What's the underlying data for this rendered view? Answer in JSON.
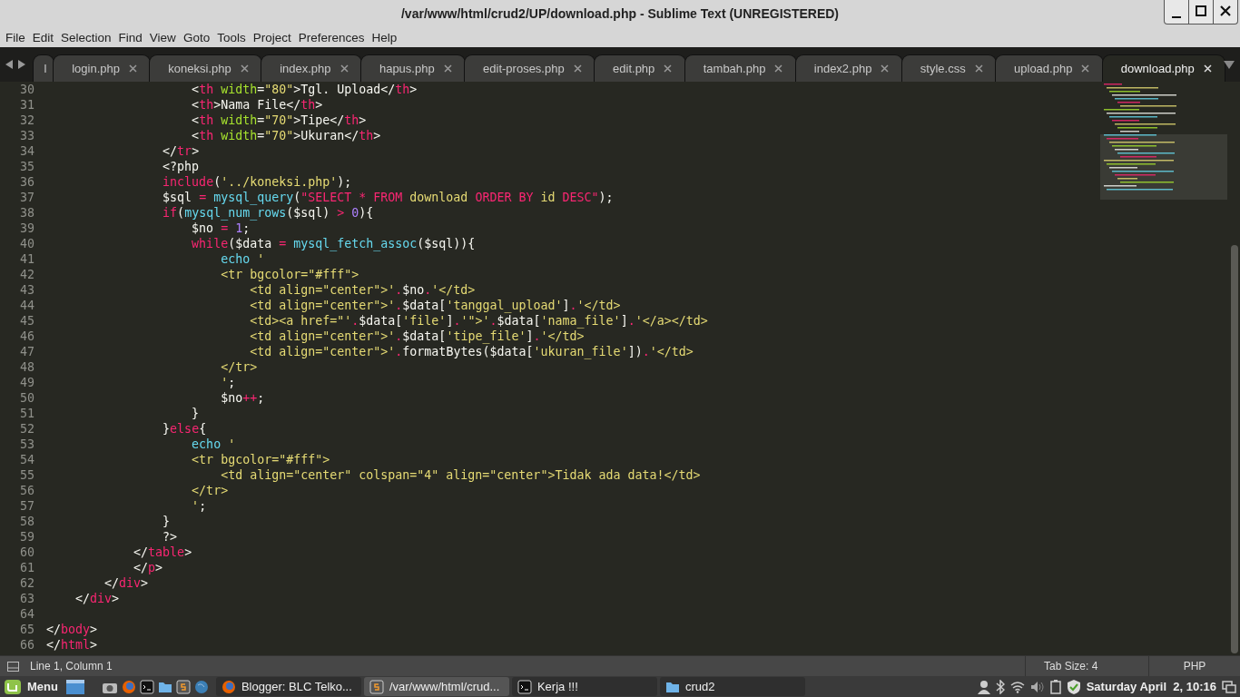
{
  "window": {
    "title": "/var/www/html/crud2/UP/download.php - Sublime Text (UNREGISTERED)"
  },
  "menu": [
    "File",
    "Edit",
    "Selection",
    "Find",
    "View",
    "Goto",
    "Tools",
    "Project",
    "Preferences",
    "Help"
  ],
  "overflow_tab": {
    "label": "l"
  },
  "tabs": [
    {
      "label": "login.php",
      "selected": false
    },
    {
      "label": "koneksi.php",
      "selected": false
    },
    {
      "label": "index.php",
      "selected": false
    },
    {
      "label": "hapus.php",
      "selected": false
    },
    {
      "label": "edit-proses.php",
      "selected": false
    },
    {
      "label": "edit.php",
      "selected": false
    },
    {
      "label": "tambah.php",
      "selected": false
    },
    {
      "label": "index2.php",
      "selected": false
    },
    {
      "label": "style.css",
      "selected": false
    },
    {
      "label": "upload.php",
      "selected": false
    },
    {
      "label": "download.php",
      "selected": true
    }
  ],
  "editor": {
    "lines": [
      {
        "number": "30",
        "tokens": [
          {
            "kind": "plain",
            "text": "                    <"
          },
          {
            "kind": "keyword",
            "text": "th"
          },
          {
            "kind": "attribute",
            "text": " width"
          },
          {
            "kind": "plain",
            "text": "="
          },
          {
            "kind": "string",
            "text": "\"80\""
          },
          {
            "kind": "plain",
            "text": ">Tgl. Upload</"
          },
          {
            "kind": "keyword",
            "text": "th"
          },
          {
            "kind": "plain",
            "text": ">"
          }
        ]
      },
      {
        "number": "31",
        "tokens": [
          {
            "kind": "plain",
            "text": "                    <"
          },
          {
            "kind": "keyword",
            "text": "th"
          },
          {
            "kind": "plain",
            "text": ">Nama File</"
          },
          {
            "kind": "keyword",
            "text": "th"
          },
          {
            "kind": "plain",
            "text": ">"
          }
        ]
      },
      {
        "number": "32",
        "tokens": [
          {
            "kind": "plain",
            "text": "                    <"
          },
          {
            "kind": "keyword",
            "text": "th"
          },
          {
            "kind": "attribute",
            "text": " width"
          },
          {
            "kind": "plain",
            "text": "="
          },
          {
            "kind": "string",
            "text": "\"70\""
          },
          {
            "kind": "plain",
            "text": ">Tipe</"
          },
          {
            "kind": "keyword",
            "text": "th"
          },
          {
            "kind": "plain",
            "text": ">"
          }
        ]
      },
      {
        "number": "33",
        "tokens": [
          {
            "kind": "plain",
            "text": "                    <"
          },
          {
            "kind": "keyword",
            "text": "th"
          },
          {
            "kind": "attribute",
            "text": " width"
          },
          {
            "kind": "plain",
            "text": "="
          },
          {
            "kind": "string",
            "text": "\"70\""
          },
          {
            "kind": "plain",
            "text": ">Ukuran</"
          },
          {
            "kind": "keyword",
            "text": "th"
          },
          {
            "kind": "plain",
            "text": ">"
          }
        ]
      },
      {
        "number": "34",
        "tokens": [
          {
            "kind": "plain",
            "text": "                </"
          },
          {
            "kind": "keyword",
            "text": "tr"
          },
          {
            "kind": "plain",
            "text": ">"
          }
        ]
      },
      {
        "number": "35",
        "tokens": [
          {
            "kind": "plain",
            "text": "                <?php"
          }
        ]
      },
      {
        "number": "36",
        "tokens": [
          {
            "kind": "keyword",
            "text": "                include"
          },
          {
            "kind": "plain",
            "text": "("
          },
          {
            "kind": "string",
            "text": "'../koneksi.php'"
          },
          {
            "kind": "plain",
            "text": ");"
          }
        ]
      },
      {
        "number": "37",
        "tokens": [
          {
            "kind": "plain",
            "text": "                $sql "
          },
          {
            "kind": "keyword",
            "text": "="
          },
          {
            "kind": "function",
            "text": " mysql_query"
          },
          {
            "kind": "plain",
            "text": "("
          },
          {
            "kind": "keyword",
            "text": "\"SELECT * FROM "
          },
          {
            "kind": "string",
            "text": "download "
          },
          {
            "kind": "keyword",
            "text": "ORDER BY "
          },
          {
            "kind": "string",
            "text": "id "
          },
          {
            "kind": "keyword",
            "text": "DESC\""
          },
          {
            "kind": "plain",
            "text": ");"
          }
        ]
      },
      {
        "number": "38",
        "tokens": [
          {
            "kind": "keyword",
            "text": "                if"
          },
          {
            "kind": "plain",
            "text": "("
          },
          {
            "kind": "function",
            "text": "mysql_num_rows"
          },
          {
            "kind": "plain",
            "text": "($sql) "
          },
          {
            "kind": "keyword",
            "text": ">"
          },
          {
            "kind": "number",
            "text": " 0"
          },
          {
            "kind": "plain",
            "text": "){"
          }
        ]
      },
      {
        "number": "39",
        "tokens": [
          {
            "kind": "plain",
            "text": "                    $no "
          },
          {
            "kind": "keyword",
            "text": "="
          },
          {
            "kind": "number",
            "text": " 1"
          },
          {
            "kind": "plain",
            "text": ";"
          }
        ]
      },
      {
        "number": "40",
        "tokens": [
          {
            "kind": "keyword",
            "text": "                    while"
          },
          {
            "kind": "plain",
            "text": "($data "
          },
          {
            "kind": "keyword",
            "text": "="
          },
          {
            "kind": "function",
            "text": " mysql_fetch_assoc"
          },
          {
            "kind": "plain",
            "text": "($sql)){"
          }
        ]
      },
      {
        "number": "41",
        "tokens": [
          {
            "kind": "function",
            "text": "                        echo"
          },
          {
            "kind": "string",
            "text": " '"
          }
        ]
      },
      {
        "number": "42",
        "tokens": [
          {
            "kind": "string",
            "text": "                        <tr bgcolor=\"#fff\">"
          }
        ]
      },
      {
        "number": "43",
        "tokens": [
          {
            "kind": "string",
            "text": "                            <td align=\"center\">'"
          },
          {
            "kind": "concat",
            "text": ".$no."
          },
          {
            "kind": "string",
            "text": "'</td>"
          }
        ]
      },
      {
        "number": "44",
        "tokens": [
          {
            "kind": "string",
            "text": "                            <td align=\"center\">'"
          },
          {
            "kind": "concat",
            "text": ".$data["
          },
          {
            "kind": "string",
            "text": "'tanggal_upload'"
          },
          {
            "kind": "concat",
            "text": "]."
          },
          {
            "kind": "string",
            "text": "'</td>"
          }
        ]
      },
      {
        "number": "45",
        "tokens": [
          {
            "kind": "string",
            "text": "                            <td><a href=\"'"
          },
          {
            "kind": "concat",
            "text": ".$data["
          },
          {
            "kind": "string",
            "text": "'file'"
          },
          {
            "kind": "concat",
            "text": "]."
          },
          {
            "kind": "string",
            "text": "'\">'"
          },
          {
            "kind": "concat",
            "text": ".$data["
          },
          {
            "kind": "string",
            "text": "'nama_file'"
          },
          {
            "kind": "concat",
            "text": "]."
          },
          {
            "kind": "string",
            "text": "'</a></td>"
          }
        ]
      },
      {
        "number": "46",
        "tokens": [
          {
            "kind": "string",
            "text": "                            <td align=\"center\">'"
          },
          {
            "kind": "concat",
            "text": ".$data["
          },
          {
            "kind": "string",
            "text": "'tipe_file'"
          },
          {
            "kind": "concat",
            "text": "]."
          },
          {
            "kind": "string",
            "text": "'</td>"
          }
        ]
      },
      {
        "number": "47",
        "tokens": [
          {
            "kind": "string",
            "text": "                            <td align=\"center\">'"
          },
          {
            "kind": "concat",
            "text": ".formatBytes($data["
          },
          {
            "kind": "string",
            "text": "'ukuran_file'"
          },
          {
            "kind": "concat",
            "text": "])."
          },
          {
            "kind": "string",
            "text": "'</td>"
          }
        ]
      },
      {
        "number": "48",
        "tokens": [
          {
            "kind": "string",
            "text": "                        </tr>"
          }
        ]
      },
      {
        "number": "49",
        "tokens": [
          {
            "kind": "string",
            "text": "                        '"
          },
          {
            "kind": "plain",
            "text": ";"
          }
        ]
      },
      {
        "number": "50",
        "tokens": [
          {
            "kind": "plain",
            "text": "                        $no"
          },
          {
            "kind": "keyword",
            "text": "++"
          },
          {
            "kind": "plain",
            "text": ";"
          }
        ]
      },
      {
        "number": "51",
        "tokens": [
          {
            "kind": "plain",
            "text": "                    }"
          }
        ]
      },
      {
        "number": "52",
        "tokens": [
          {
            "kind": "plain",
            "text": "                }"
          },
          {
            "kind": "keyword",
            "text": "else"
          },
          {
            "kind": "plain",
            "text": "{"
          }
        ]
      },
      {
        "number": "53",
        "tokens": [
          {
            "kind": "function",
            "text": "                    echo"
          },
          {
            "kind": "string",
            "text": " '"
          }
        ]
      },
      {
        "number": "54",
        "tokens": [
          {
            "kind": "string",
            "text": "                    <tr bgcolor=\"#fff\">"
          }
        ]
      },
      {
        "number": "55",
        "tokens": [
          {
            "kind": "string",
            "text": "                        <td align=\"center\" colspan=\"4\" align=\"center\">Tidak ada data!</td>"
          }
        ]
      },
      {
        "number": "56",
        "tokens": [
          {
            "kind": "string",
            "text": "                    </tr>"
          }
        ]
      },
      {
        "number": "57",
        "tokens": [
          {
            "kind": "string",
            "text": "                    '"
          },
          {
            "kind": "plain",
            "text": ";"
          }
        ]
      },
      {
        "number": "58",
        "tokens": [
          {
            "kind": "plain",
            "text": "                }"
          }
        ]
      },
      {
        "number": "59",
        "tokens": [
          {
            "kind": "plain",
            "text": "                ?>"
          }
        ]
      },
      {
        "number": "60",
        "tokens": [
          {
            "kind": "plain",
            "text": "            </"
          },
          {
            "kind": "keyword",
            "text": "table"
          },
          {
            "kind": "plain",
            "text": ">"
          }
        ]
      },
      {
        "number": "61",
        "tokens": [
          {
            "kind": "plain",
            "text": "            </"
          },
          {
            "kind": "keyword",
            "text": "p"
          },
          {
            "kind": "plain",
            "text": ">"
          }
        ]
      },
      {
        "number": "62",
        "tokens": [
          {
            "kind": "plain",
            "text": "        </"
          },
          {
            "kind": "keyword",
            "text": "div"
          },
          {
            "kind": "plain",
            "text": ">"
          }
        ]
      },
      {
        "number": "63",
        "tokens": [
          {
            "kind": "plain",
            "text": "    </"
          },
          {
            "kind": "keyword",
            "text": "div"
          },
          {
            "kind": "plain",
            "text": ">"
          }
        ]
      },
      {
        "number": "64"
      },
      {
        "number": "65",
        "tokens": [
          {
            "kind": "plain",
            "text": "</"
          },
          {
            "kind": "keyword",
            "text": "body"
          },
          {
            "kind": "plain",
            "text": ">"
          }
        ]
      },
      {
        "number": "66",
        "tokens": [
          {
            "kind": "plain",
            "text": "</"
          },
          {
            "kind": "keyword",
            "text": "html"
          },
          {
            "kind": "plain",
            "text": ">"
          }
        ]
      }
    ]
  },
  "status_bar": {
    "position": "Line 1, Column 1",
    "tab_size": "Tab Size: 4",
    "syntax": "PHP"
  },
  "taskbar": {
    "menu_label": "Menu",
    "windows": [
      {
        "label": "Blogger: BLC Telko...",
        "kind": "browser",
        "selected": false
      },
      {
        "label": "/var/www/html/crud...",
        "kind": "editor",
        "selected": true
      },
      {
        "label": "Kerja !!!",
        "kind": "terminal",
        "selected": false
      },
      {
        "label": "crud2",
        "kind": "folder",
        "selected": false
      }
    ],
    "clock": "Saturday April  2, 10:16"
  }
}
